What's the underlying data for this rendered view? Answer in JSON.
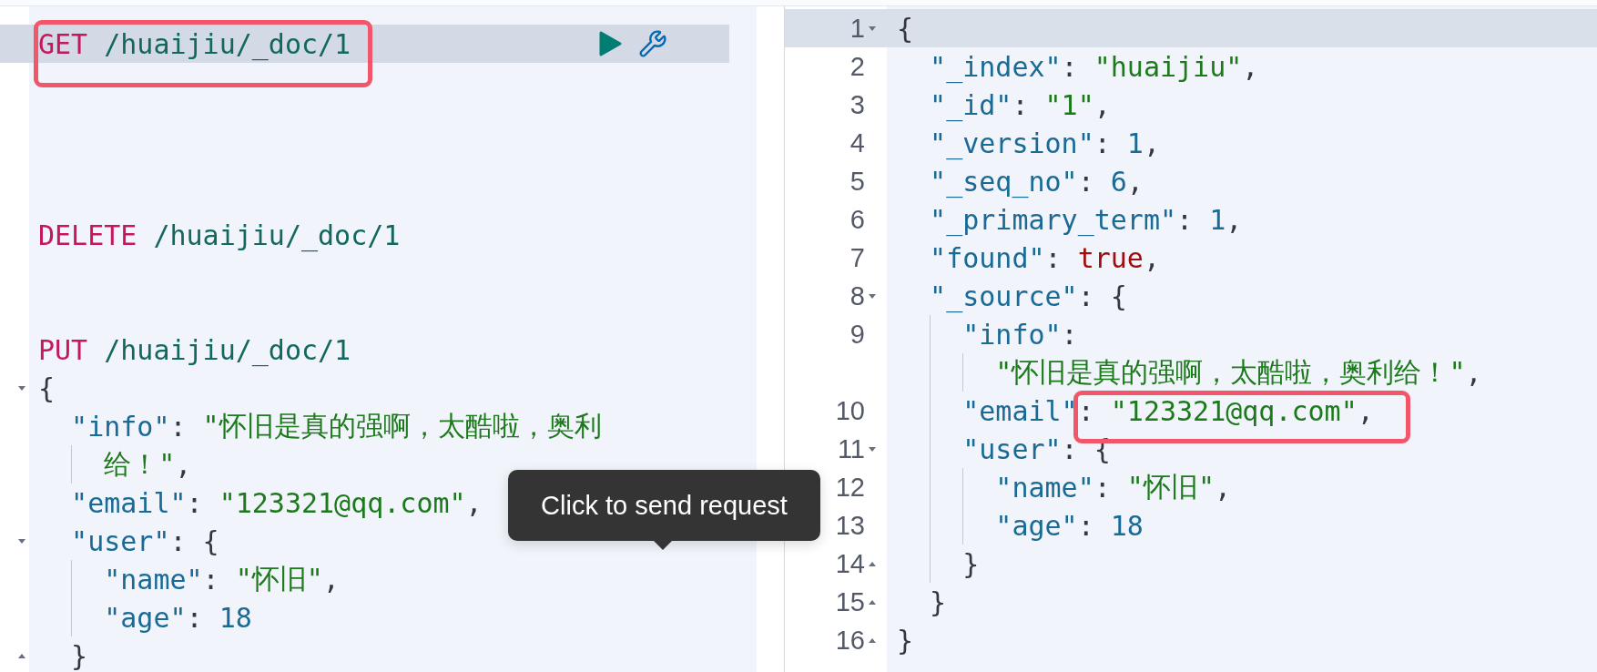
{
  "request_editor": {
    "lines": [
      {
        "kind": "request",
        "active": true,
        "tokens": [
          {
            "kind": "method",
            "text": "GET"
          },
          {
            "kind": "url",
            "text": "/huaijiu/_doc/1"
          }
        ]
      },
      {
        "kind": "blank",
        "active": false
      },
      {
        "kind": "blank",
        "active": false
      },
      {
        "kind": "blank",
        "active": false
      },
      {
        "kind": "blank",
        "active": false
      },
      {
        "kind": "request",
        "active": false,
        "tokens": [
          {
            "kind": "method",
            "text": "DELETE"
          },
          {
            "kind": "url",
            "text": "/huaijiu/_doc/1"
          }
        ]
      },
      {
        "kind": "blank",
        "active": false
      },
      {
        "kind": "blank",
        "active": false
      },
      {
        "kind": "request",
        "active": false,
        "tokens": [
          {
            "kind": "method",
            "text": "PUT"
          },
          {
            "kind": "url",
            "text": "/huaijiu/_doc/1"
          }
        ]
      },
      {
        "kind": "json",
        "active": false,
        "expanded": true,
        "tokens": [
          {
            "kind": "punct",
            "text": "{"
          }
        ],
        "children": [
          {
            "kind": "json",
            "active": false,
            "tokens": [
              {
                "kind": "key",
                "text": "\"info\""
              },
              {
                "kind": "punct",
                "text": ": "
              },
              {
                "kind": "string",
                "text": "\"怀旧是真的强啊，太酷啦，奥利"
              }
            ],
            "continuation": [
              {
                "kind": "string",
                "text": "给！\""
              },
              {
                "kind": "punct",
                "text": ","
              }
            ]
          },
          {
            "kind": "json",
            "active": false,
            "tokens": [
              {
                "kind": "key",
                "text": "\"email\""
              },
              {
                "kind": "punct",
                "text": ": "
              },
              {
                "kind": "string",
                "text": "\"123321@qq.com\""
              },
              {
                "kind": "punct",
                "text": ","
              }
            ]
          },
          {
            "kind": "json",
            "active": false,
            "expanded": true,
            "tokens": [
              {
                "kind": "key",
                "text": "\"user\""
              },
              {
                "kind": "punct",
                "text": ": {"
              }
            ],
            "children": [
              {
                "kind": "json",
                "active": false,
                "tokens": [
                  {
                    "kind": "key",
                    "text": "\"name\""
                  },
                  {
                    "kind": "punct",
                    "text": ": "
                  },
                  {
                    "kind": "string",
                    "text": "\"怀旧\""
                  },
                  {
                    "kind": "punct",
                    "text": ","
                  }
                ]
              },
              {
                "kind": "json",
                "active": false,
                "tokens": [
                  {
                    "kind": "key",
                    "text": "\"age\""
                  },
                  {
                    "kind": "punct",
                    "text": ": "
                  },
                  {
                    "kind": "number",
                    "text": "18"
                  }
                ]
              }
            ],
            "close": {
              "tokens": [
                {
                  "kind": "punct",
                  "text": "}"
                }
              ]
            }
          }
        ]
      }
    ]
  },
  "tooltip": {
    "text": "Click to send request"
  },
  "response_editor": {
    "lines": [
      {
        "kind": "json",
        "active": true,
        "number": "1",
        "expanded": true,
        "tokens": [
          {
            "kind": "punct",
            "text": "{"
          }
        ],
        "children": [
          {
            "kind": "json",
            "active": false,
            "number": "2",
            "tokens": [
              {
                "kind": "key",
                "text": "\"_index\""
              },
              {
                "kind": "punct",
                "text": ": "
              },
              {
                "kind": "string",
                "text": "\"huaijiu\""
              },
              {
                "kind": "punct",
                "text": ","
              }
            ]
          },
          {
            "kind": "json",
            "active": false,
            "number": "3",
            "tokens": [
              {
                "kind": "key",
                "text": "\"_id\""
              },
              {
                "kind": "punct",
                "text": ": "
              },
              {
                "kind": "string",
                "text": "\"1\""
              },
              {
                "kind": "punct",
                "text": ","
              }
            ]
          },
          {
            "kind": "json",
            "active": false,
            "number": "4",
            "tokens": [
              {
                "kind": "key",
                "text": "\"_version\""
              },
              {
                "kind": "punct",
                "text": ": "
              },
              {
                "kind": "number",
                "text": "1"
              },
              {
                "kind": "punct",
                "text": ","
              }
            ]
          },
          {
            "kind": "json",
            "active": false,
            "number": "5",
            "tokens": [
              {
                "kind": "key",
                "text": "\"_seq_no\""
              },
              {
                "kind": "punct",
                "text": ": "
              },
              {
                "kind": "number",
                "text": "6"
              },
              {
                "kind": "punct",
                "text": ","
              }
            ]
          },
          {
            "kind": "json",
            "active": false,
            "number": "6",
            "tokens": [
              {
                "kind": "key",
                "text": "\"_primary_term\""
              },
              {
                "kind": "punct",
                "text": ": "
              },
              {
                "kind": "number",
                "text": "1"
              },
              {
                "kind": "punct",
                "text": ","
              }
            ]
          },
          {
            "kind": "json",
            "active": false,
            "number": "7",
            "tokens": [
              {
                "kind": "key",
                "text": "\"found\""
              },
              {
                "kind": "punct",
                "text": ": "
              },
              {
                "kind": "boolean",
                "text": "true"
              },
              {
                "kind": "punct",
                "text": ","
              }
            ]
          },
          {
            "kind": "json",
            "active": false,
            "number": "8",
            "expanded": true,
            "tokens": [
              {
                "kind": "key",
                "text": "\"_source\""
              },
              {
                "kind": "punct",
                "text": ": {"
              }
            ],
            "children": [
              {
                "kind": "json",
                "active": false,
                "number": "9",
                "tokens": [
                  {
                    "kind": "key",
                    "text": "\"info\""
                  },
                  {
                    "kind": "punct",
                    "text": ":"
                  }
                ],
                "continuation": [
                  {
                    "kind": "string",
                    "text": "\"怀旧是真的强啊，太酷啦，奥利给！\""
                  },
                  {
                    "kind": "punct",
                    "text": ","
                  }
                ]
              },
              {
                "kind": "json",
                "active": false,
                "number": "10",
                "tokens": [
                  {
                    "kind": "key",
                    "text": "\"email\""
                  },
                  {
                    "kind": "punct",
                    "text": ": "
                  },
                  {
                    "kind": "string",
                    "text": "\"123321@qq.com\""
                  },
                  {
                    "kind": "punct",
                    "text": ","
                  }
                ]
              },
              {
                "kind": "json",
                "active": false,
                "number": "11",
                "expanded": true,
                "tokens": [
                  {
                    "kind": "key",
                    "text": "\"user\""
                  },
                  {
                    "kind": "punct",
                    "text": ": {"
                  }
                ],
                "children": [
                  {
                    "kind": "json",
                    "active": false,
                    "number": "12",
                    "tokens": [
                      {
                        "kind": "key",
                        "text": "\"name\""
                      },
                      {
                        "kind": "punct",
                        "text": ": "
                      },
                      {
                        "kind": "string",
                        "text": "\"怀旧\""
                      },
                      {
                        "kind": "punct",
                        "text": ","
                      }
                    ]
                  },
                  {
                    "kind": "json",
                    "active": false,
                    "number": "13",
                    "tokens": [
                      {
                        "kind": "key",
                        "text": "\"age\""
                      },
                      {
                        "kind": "punct",
                        "text": ": "
                      },
                      {
                        "kind": "number",
                        "text": "18"
                      }
                    ]
                  }
                ],
                "close": {
                  "number": "14",
                  "tokens": [
                    {
                      "kind": "punct",
                      "text": "}"
                    }
                  ]
                }
              }
            ],
            "close": {
              "number": "15",
              "tokens": [
                {
                  "kind": "punct",
                  "text": "}"
                }
              ]
            }
          }
        ],
        "close": {
          "number": "16",
          "tokens": [
            {
              "kind": "punct",
              "text": "}"
            }
          ]
        }
      }
    ]
  }
}
